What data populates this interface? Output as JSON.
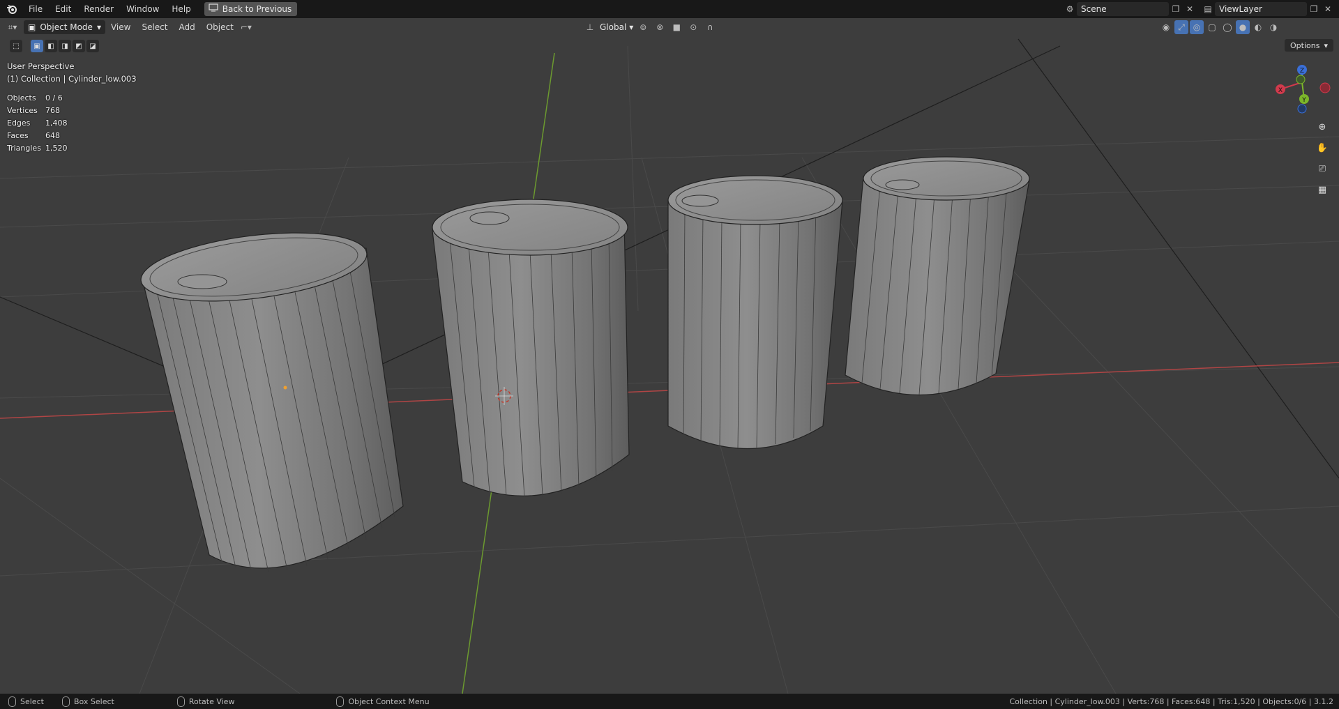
{
  "menu": {
    "file": "File",
    "edit": "Edit",
    "render": "Render",
    "window": "Window",
    "help": "Help",
    "back": "Back to Previous"
  },
  "scene": {
    "name": "Scene"
  },
  "view_layer": {
    "name": "ViewLayer"
  },
  "header": {
    "mode": "Object Mode",
    "view": "View",
    "select": "Select",
    "add": "Add",
    "object": "Object",
    "orientation": "Global",
    "options": "Options"
  },
  "overlay": {
    "perspective": "User Perspective",
    "collection": "(1) Collection | Cylinder_low.003"
  },
  "stats": {
    "objects_label": "Objects",
    "objects": "0 / 6",
    "vertices_label": "Vertices",
    "vertices": "768",
    "edges_label": "Edges",
    "edges": "1,408",
    "faces_label": "Faces",
    "faces": "648",
    "triangles_label": "Triangles",
    "triangles": "1,520"
  },
  "gizmo": {
    "x": "X",
    "y": "Y",
    "z": "Z"
  },
  "status": {
    "select": "Select",
    "box_select": "Box Select",
    "rotate_view": "Rotate View",
    "context_menu": "Object Context Menu",
    "info": "Collection | Cylinder_low.003 | Verts:768 | Faces:648 | Tris:1,520 | Objects:0/6 | 3.1.2"
  },
  "colors": {
    "bg": "#3d3d3d",
    "header": "#181818",
    "accent": "#4772b3",
    "axis_x": "#c0392b",
    "axis_y": "#6aa12a",
    "mesh": "#8c8c8c"
  }
}
